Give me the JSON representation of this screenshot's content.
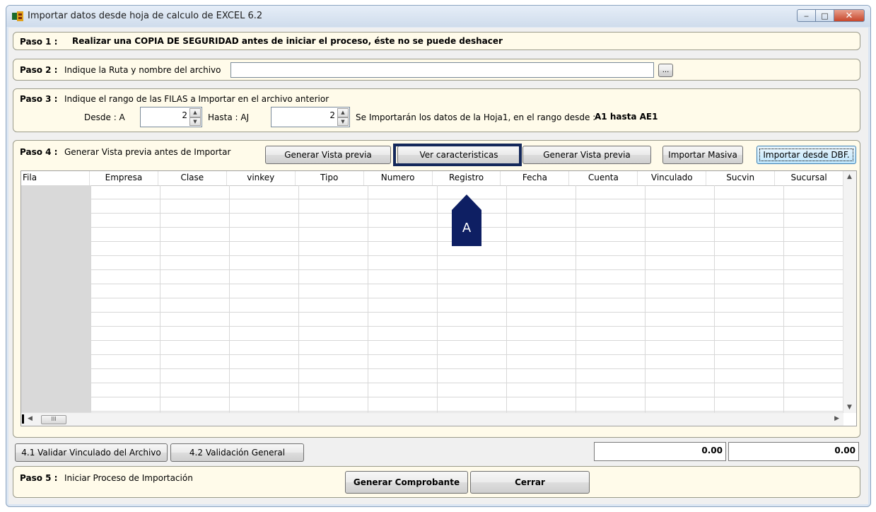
{
  "window": {
    "title": "Importar datos desde hoja de calculo de EXCEL 6.2",
    "controls": {
      "minimize": "‒",
      "maximize": "□",
      "close": "✕"
    }
  },
  "paso1": {
    "label": "Paso 1 :",
    "text": "Realizar una COPIA DE SEGURIDAD antes de iniciar el proceso, éste no se puede deshacer"
  },
  "paso2": {
    "label": "Paso 2 :",
    "text": "Indique la Ruta y nombre del archivo",
    "path_value": "",
    "browse_label": "..."
  },
  "paso3": {
    "label": "Paso 3 :",
    "text": "Indique el rango de las FILAS a Importar en el archivo anterior",
    "desde_label": "Desde  :  A",
    "desde_value": "2",
    "hasta_label": "Hasta  :  AJ",
    "hasta_value": "2",
    "info_text": "Se Importarán los datos de la Hoja1,  en el rango desde :",
    "range_text": "A1 hasta AE1"
  },
  "paso4": {
    "label": "Paso 4 :",
    "text": "Generar Vista previa antes de Importar",
    "buttons": {
      "vista1": "Generar Vista previa",
      "caracteristicas": "Ver caracteristicas",
      "vista2": "Generar Vista previa",
      "masiva": "Importar Masiva",
      "dbf": "Importar desde DBF."
    }
  },
  "grid": {
    "columns": [
      "Fila",
      "Empresa",
      "Clase",
      "vinkey",
      "Tipo",
      "Numero",
      "Registro",
      "Fecha",
      "Cuenta",
      "Vinculado",
      "Sucvin",
      "Sucursal"
    ],
    "row_count": 17,
    "hscroll_thumb": "III"
  },
  "callout": {
    "label": "A"
  },
  "validation": {
    "vinculado_label": "4.1 Validar Vinculado  del  Archivo",
    "general_label": "4.2  Validación General",
    "total1": "0.00",
    "total2": "0.00"
  },
  "paso5": {
    "label": "Paso 5 :",
    "text": "Iniciar Proceso de Importación",
    "generar_label": "Generar Comprobante",
    "cerrar_label": "Cerrar"
  },
  "colors": {
    "panel_bg": "#fffbea",
    "marker": "#0e1f63",
    "window_frame": "#dbe6f3"
  }
}
